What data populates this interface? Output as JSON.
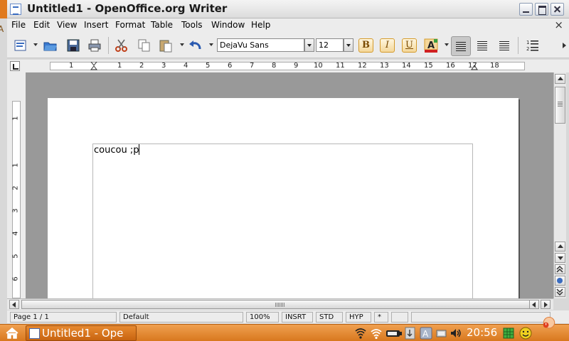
{
  "window": {
    "title": "Untitled1 - OpenOffice.org Writer"
  },
  "menu": [
    "File",
    "Edit",
    "View",
    "Insert",
    "Format",
    "Table",
    "Tools",
    "Window",
    "Help"
  ],
  "menu_close": "×",
  "toolbar": {
    "font_name": "DejaVu Sans",
    "font_size": "12",
    "bold": "B",
    "italic": "I",
    "underline": "U",
    "icons": [
      "document-icon",
      "open-icon",
      "save-icon",
      "print-icon",
      "cut-icon",
      "copy-icon",
      "paste-icon",
      "undo-icon",
      "font-color-icon",
      "align-left-icon",
      "align-center-icon",
      "align-right-icon",
      "numbering-icon"
    ]
  },
  "ruler": {
    "horizontal": [
      "1",
      "1",
      "2",
      "3",
      "4",
      "5",
      "6",
      "7",
      "8",
      "9",
      "10",
      "11",
      "12",
      "13",
      "14",
      "15",
      "16",
      "17",
      "18"
    ],
    "vertical": [
      "1",
      "1",
      "2",
      "3",
      "4",
      "5",
      "6"
    ]
  },
  "document": {
    "text": "coucou ;p"
  },
  "status": {
    "page": "Page 1 / 1",
    "style": "Default",
    "zoom": "100%",
    "insert_mode": "INSRT",
    "selection_mode": "STD",
    "hyphenation": "HYP",
    "modified": "*"
  },
  "taskbar": {
    "task_label": "Untitled1 - Ope",
    "clock": "20:56",
    "tray_icons": [
      "network-icon",
      "wifi-icon",
      "battery-icon",
      "update-icon",
      "keyboard-icon",
      "display-icon",
      "volume-icon",
      "grid-icon",
      "smiley-icon",
      "power-icon"
    ]
  },
  "colors": {
    "taskbar": "#e07a1e",
    "accent_button": "#f4d79a",
    "workspace": "#999999"
  }
}
